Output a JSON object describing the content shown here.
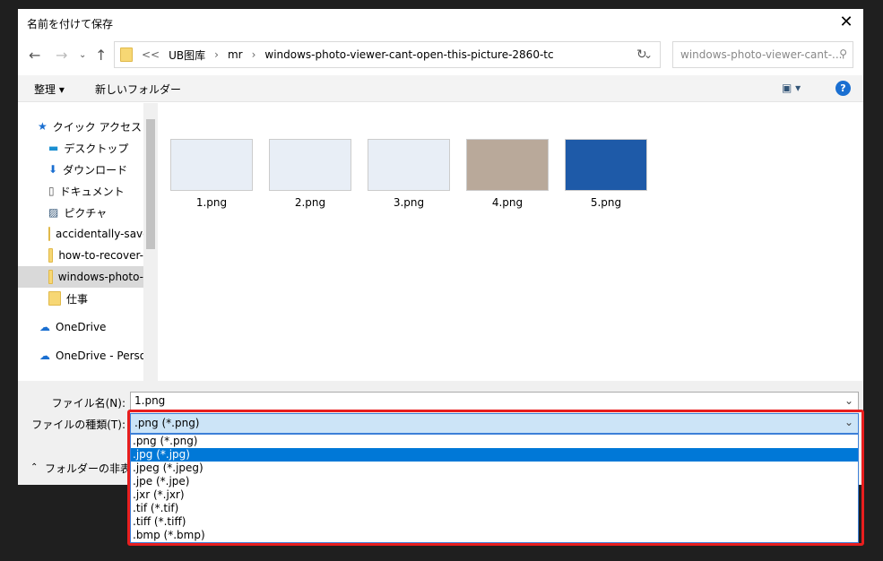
{
  "window": {
    "title": "名前を付けて保存"
  },
  "address": {
    "overflow": "<<",
    "crumbs": [
      "UB图库",
      "mr",
      "windows-photo-viewer-cant-open-this-picture-2860-tc"
    ],
    "search_placeholder": "windows-photo-viewer-cant-..."
  },
  "toolbar": {
    "organize": "整理 ▾",
    "new_folder": "新しいフォルダー"
  },
  "sidebar": {
    "items": [
      {
        "label": "クイック アクセス"
      },
      {
        "label": "デスクトップ"
      },
      {
        "label": "ダウンロード"
      },
      {
        "label": "ドキュメント"
      },
      {
        "label": "ピクチャ"
      },
      {
        "label": "accidentally-save"
      },
      {
        "label": "how-to-recover-"
      },
      {
        "label": "windows-photo-"
      },
      {
        "label": "仕事"
      },
      {
        "label": "OneDrive"
      },
      {
        "label": "OneDrive - Person"
      }
    ]
  },
  "files": [
    {
      "name": "1.png"
    },
    {
      "name": "2.png"
    },
    {
      "name": "3.png"
    },
    {
      "name": "4.png"
    },
    {
      "name": "5.png"
    }
  ],
  "form": {
    "filename_label": "ファイル名(N):",
    "filename_value": "1.png",
    "type_label": "ファイルの種類(T):",
    "type_value": ".png (*.png)",
    "hide_folders": "フォルダーの非表示"
  },
  "type_options": [
    ".png (*.png)",
    ".jpg (*.jpg)",
    ".jpeg (*.jpeg)",
    ".jpe (*.jpe)",
    ".jxr (*.jxr)",
    ".tif (*.tif)",
    ".tiff (*.tiff)",
    ".bmp (*.bmp)"
  ]
}
